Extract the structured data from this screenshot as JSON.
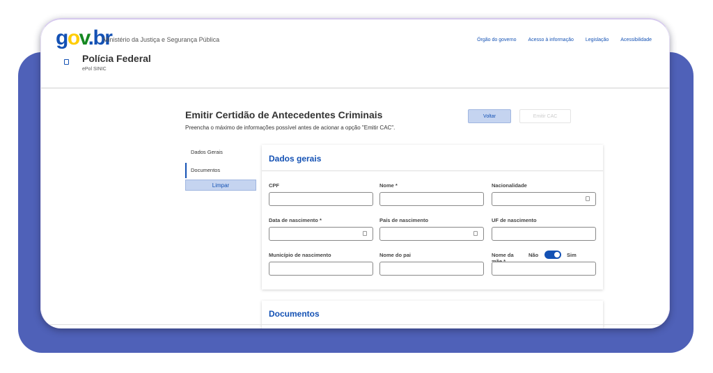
{
  "header": {
    "logo": {
      "g": "g",
      "o": "o",
      "v": "v",
      "dot": ".",
      "br": "br"
    },
    "ministry": "Ministério da Justiça e Segurança Pública",
    "links": [
      "Órgão do governo",
      "Acesso à informação",
      "Legislação",
      "Acessibilidade"
    ],
    "site_title": "Polícia Federal",
    "site_subtitle": "ePol SINIC"
  },
  "page": {
    "title": "Emitir Certidão de Antecedentes Criminais",
    "description": "Preencha o máximo de informações possível antes de acionar a opção \"Emitir CAC\".",
    "voltar_label": "Voltar",
    "emitir_label": "Emitir CAC"
  },
  "sidebar": {
    "items": [
      {
        "label": "Dados Gerais"
      },
      {
        "label": "Documentos"
      }
    ],
    "limpar_label": "Limpar"
  },
  "dados_gerais": {
    "title": "Dados gerais",
    "fields": {
      "cpf": "CPF",
      "nome": "Nome *",
      "nacionalidade": "Nacionalidade",
      "data_nascimento": "Data de nascimento *",
      "pais_nascimento": "País de nascimento",
      "uf_nascimento": "UF de nascimento",
      "municipio_nascimento": "Município de nascimento",
      "nome_pai": "Nome do pai",
      "nome_mae": "Nome da mãe *"
    },
    "toggle": {
      "nao": "Não",
      "sim": "Sim",
      "state": "Sim"
    }
  },
  "documentos": {
    "title": "Documentos"
  },
  "colors": {
    "brand_blue": "#1351b4",
    "panel": "#4f61b8"
  }
}
